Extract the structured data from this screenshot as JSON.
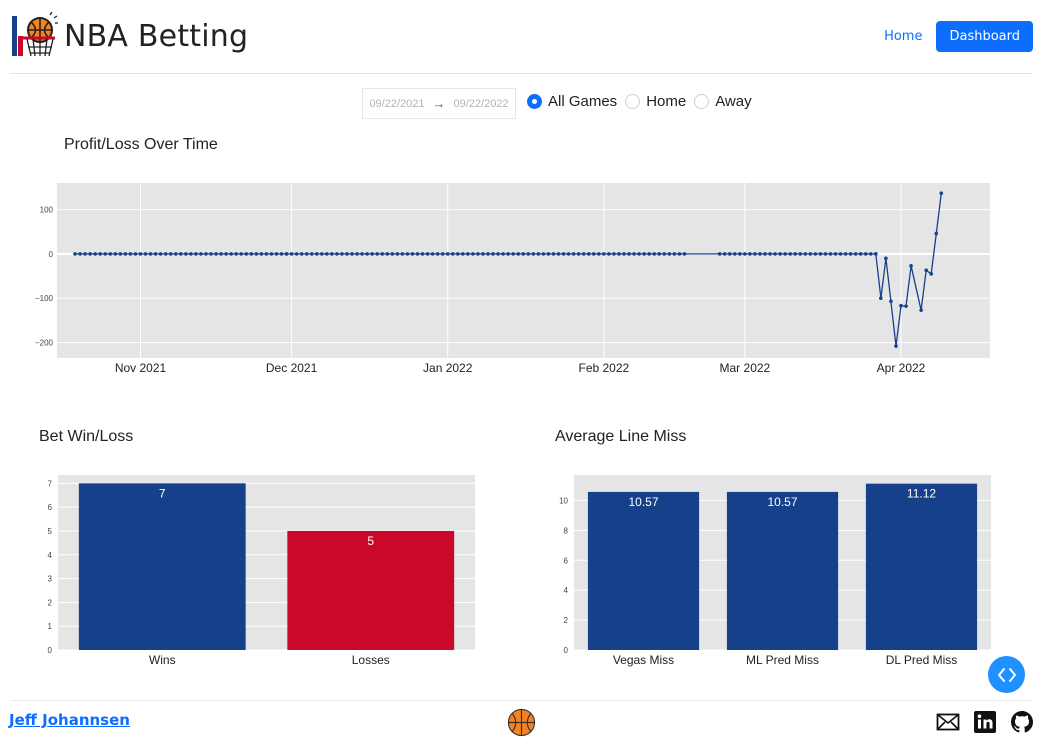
{
  "header": {
    "title": "NBA Betting",
    "nav": {
      "home": "Home",
      "dashboard": "Dashboard"
    }
  },
  "filters": {
    "start_date": "09/22/2021",
    "end_date": "09/22/2022",
    "arrow": "→",
    "options": [
      {
        "label": "All Games",
        "selected": true
      },
      {
        "label": "Home",
        "selected": false
      },
      {
        "label": "Away",
        "selected": false
      }
    ]
  },
  "footer": {
    "author": "Jeff Johannsen"
  },
  "colors": {
    "accent": "#0d6efd",
    "navy": "#17408b",
    "red": "#c9082a",
    "plot_bg": "#e5e5e5"
  },
  "icons": [
    "basketball-hoop-logo",
    "basketball-icon",
    "email-icon",
    "linkedin-icon",
    "github-icon",
    "code-toggle-icon"
  ],
  "chart_data": [
    {
      "type": "line",
      "title": "Profit/Loss Over Time",
      "x_ticks": [
        "Nov 2021",
        "Dec 2021",
        "Jan 2022",
        "Feb 2022",
        "Mar 2022",
        "Apr 2022"
      ],
      "y_ticks": [
        100,
        0,
        -100,
        -200
      ],
      "ylim": [
        -235,
        160
      ],
      "grid": true,
      "flat_segments": [
        {
          "start": "2021-10-19",
          "end": "2021-11-30",
          "value": 0
        },
        {
          "start": "2021-11-30",
          "end": "2022-02-17",
          "value": 0
        },
        {
          "start": "2022-02-24",
          "end": "2022-03-27",
          "value": 0
        }
      ],
      "points": [
        {
          "x": "2022-03-27",
          "y": 0
        },
        {
          "x": "2022-03-28",
          "y": -100
        },
        {
          "x": "2022-03-29",
          "y": -10
        },
        {
          "x": "2022-03-30",
          "y": -107
        },
        {
          "x": "2022-03-31",
          "y": -208
        },
        {
          "x": "2022-04-01",
          "y": -117
        },
        {
          "x": "2022-04-02",
          "y": -118
        },
        {
          "x": "2022-04-03",
          "y": -27
        },
        {
          "x": "2022-04-05",
          "y": -127
        },
        {
          "x": "2022-04-06",
          "y": -37
        },
        {
          "x": "2022-04-07",
          "y": -45
        },
        {
          "x": "2022-04-08",
          "y": 46
        },
        {
          "x": "2022-04-09",
          "y": 137
        }
      ]
    },
    {
      "type": "bar",
      "title": "Bet Win/Loss",
      "categories": [
        "Wins",
        "Losses"
      ],
      "values": [
        7,
        5
      ],
      "colors": [
        "#17408b",
        "#c9082a"
      ],
      "y_ticks": [
        0,
        1,
        2,
        3,
        4,
        5,
        6,
        7
      ],
      "ylim": [
        0,
        7.35
      ]
    },
    {
      "type": "bar",
      "title": "Average Line Miss",
      "categories": [
        "Vegas Miss",
        "ML Pred Miss",
        "DL Pred Miss"
      ],
      "values": [
        10.57,
        10.57,
        11.12
      ],
      "colors": [
        "#17408b",
        "#17408b",
        "#17408b"
      ],
      "y_ticks": [
        0,
        2,
        4,
        6,
        8,
        10
      ],
      "ylim": [
        0,
        11.7
      ]
    }
  ]
}
